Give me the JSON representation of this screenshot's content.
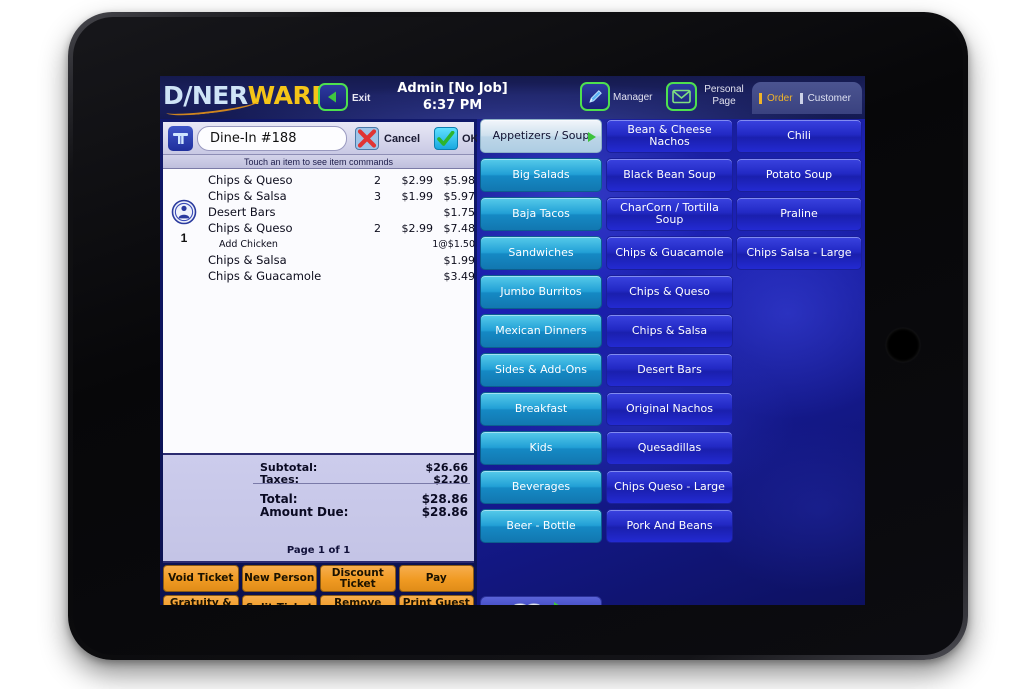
{
  "app": {
    "logo_part1": "D/NER",
    "logo_part2": "WARE",
    "logo_reg": "®"
  },
  "topbar": {
    "back_icon": "back-arrow-icon",
    "exit_label": "Exit",
    "user": "Admin [No Job]",
    "time": "6:37 PM",
    "manager_icon": "pencil-icon",
    "manager_label": "Manager",
    "personal_icon": "envelope-icon",
    "personal_label_line1": "Personal",
    "personal_label_line2": "Page",
    "tabs": [
      {
        "label": "Order",
        "active": true
      },
      {
        "label": "Customer",
        "active": false
      }
    ]
  },
  "ticket": {
    "type_icon": "table-icon",
    "name": "Dine-In #188",
    "cancel_icon": "red-x-icon",
    "cancel_label": "Cancel",
    "ok_icon": "green-check-icon",
    "ok_label": "OK",
    "hint": "Touch an item to see item commands",
    "seat_icon": "seat-person-icon",
    "seat_number": "1",
    "items": [
      {
        "name": "Chips & Queso",
        "qty": "2",
        "unit": "$2.99",
        "total": "$5.98",
        "modifier": false
      },
      {
        "name": "Chips & Salsa",
        "qty": "3",
        "unit": "$1.99",
        "total": "$5.97",
        "modifier": false
      },
      {
        "name": "Desert Bars",
        "qty": "",
        "unit": "",
        "total": "$1.75",
        "modifier": false
      },
      {
        "name": "Chips & Queso",
        "qty": "2",
        "unit": "$2.99",
        "total": "$7.48",
        "modifier": false
      },
      {
        "name": "Add Chicken",
        "qty": "",
        "unit": "",
        "total": "1@$1.50",
        "modifier": true
      },
      {
        "name": "Chips & Salsa",
        "qty": "",
        "unit": "",
        "total": "$1.99",
        "modifier": false
      },
      {
        "name": "Chips & Guacamole",
        "qty": "",
        "unit": "",
        "total": "$3.49",
        "modifier": false
      }
    ],
    "totals": [
      {
        "label": "Subtotal:",
        "value": "$26.66"
      },
      {
        "label": "Taxes:",
        "value": "$2.20"
      },
      {
        "label": "Total:",
        "value": "$28.86"
      },
      {
        "label": "Amount Due:",
        "value": "$28.86"
      }
    ],
    "page_indicator": "Page 1 of 1",
    "actions": [
      "Void Ticket",
      "New Person",
      "Discount Ticket",
      "Pay",
      "Gratuity & Taxes",
      "Split Ticket",
      "Remove Discount",
      "Print Guest Check"
    ]
  },
  "menu": {
    "categories": [
      {
        "label": "Appetizers / Soup",
        "selected": true
      },
      {
        "label": "Big Salads",
        "selected": false
      },
      {
        "label": "Baja Tacos",
        "selected": false
      },
      {
        "label": "Sandwiches",
        "selected": false
      },
      {
        "label": "Jumbo Burritos",
        "selected": false
      },
      {
        "label": "Mexican Dinners",
        "selected": false
      },
      {
        "label": "Sides & Add-Ons",
        "selected": false
      },
      {
        "label": "Breakfast",
        "selected": false
      },
      {
        "label": "Kids",
        "selected": false
      },
      {
        "label": "Beverages",
        "selected": false
      },
      {
        "label": "Beer - Bottle",
        "selected": false
      }
    ],
    "items_col_a": [
      "Bean & Cheese Nachos",
      "Black Bean Soup",
      "CharCorn / Tortilla Soup",
      "Chips & Guacamole",
      "Chips & Queso",
      "Chips & Salsa",
      "Desert Bars",
      "Original Nachos",
      "Quesadillas",
      "Chips Queso - Large",
      "Pork And Beans"
    ],
    "items_col_b": [
      "Chili",
      "Potato Soup",
      "Praline",
      "Chips Salsa - Large"
    ],
    "page_nav": {
      "book_icon": "open-book-icon",
      "next_icon": "green-next-arrow-icon"
    }
  },
  "device": {
    "home_button": "home-button"
  }
}
